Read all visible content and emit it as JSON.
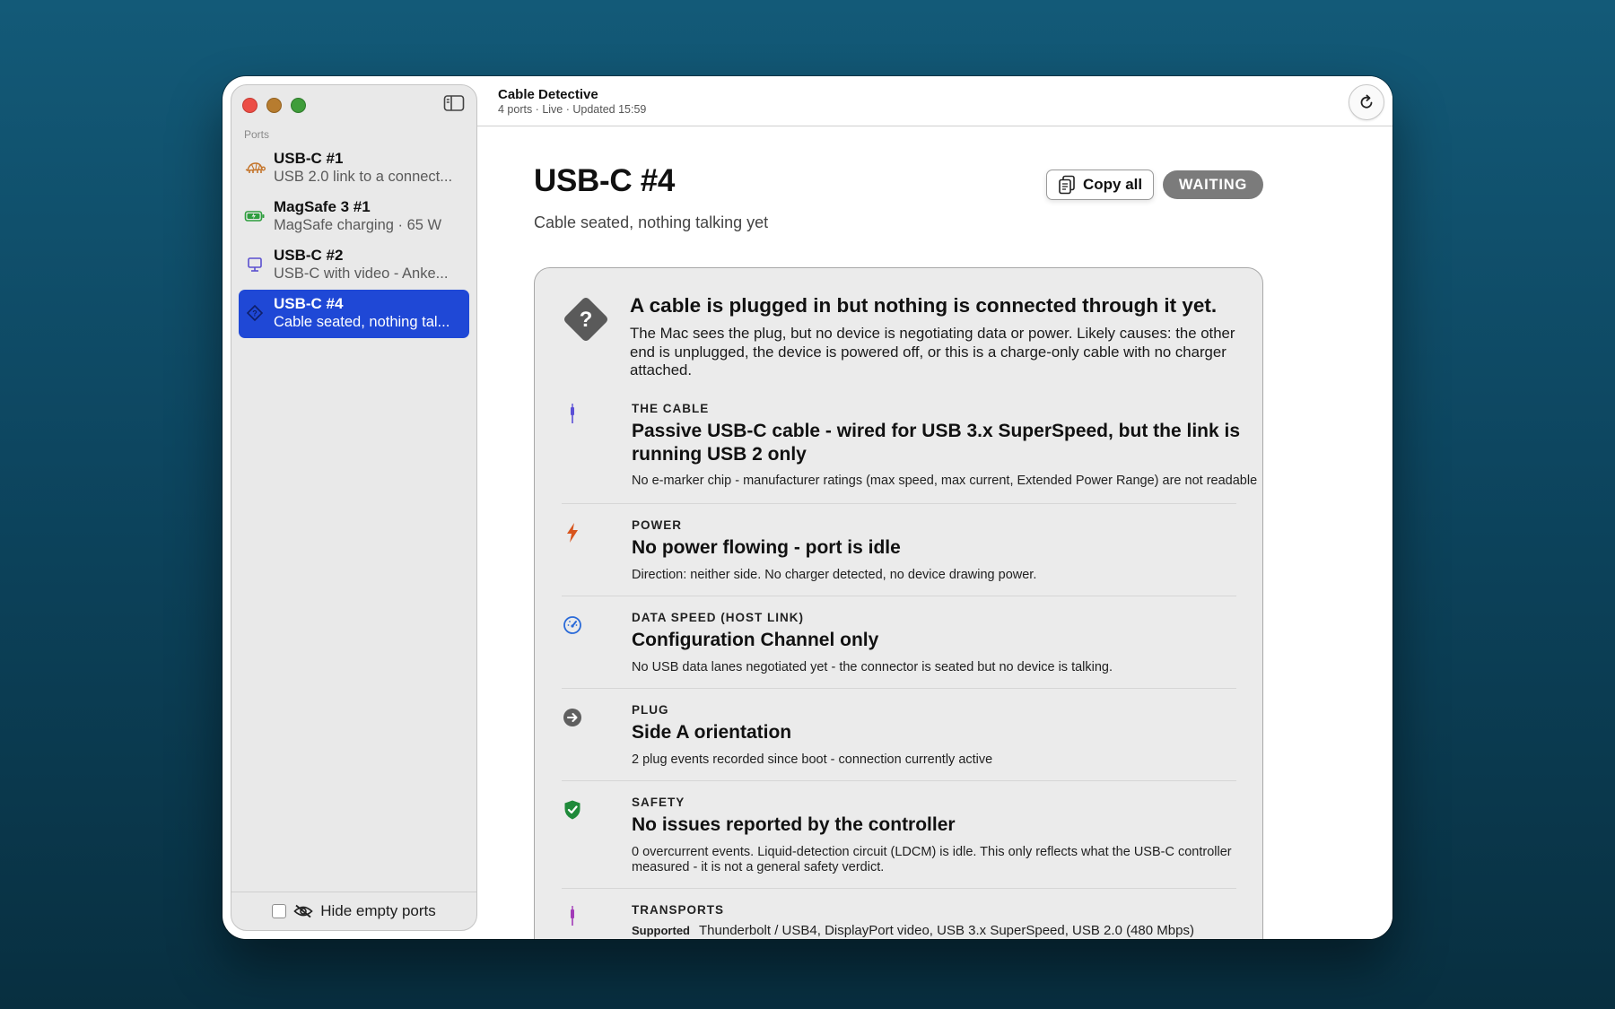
{
  "app": {
    "title": "Cable Detective",
    "subtitle": "4 ports · Live · Updated 15:59"
  },
  "sidebar": {
    "section_label": "Ports",
    "items": [
      {
        "title": "USB-C #1",
        "subtitle": "USB 2.0 link to a connect...",
        "icon": "turtle-icon",
        "icon_color": "#c4742a",
        "selected": false
      },
      {
        "title": "MagSafe 3 #1",
        "subtitle": "MagSafe charging · 65 W",
        "icon": "battery-charging-icon",
        "icon_color": "#2e9e3e",
        "selected": false
      },
      {
        "title": "USB-C #2",
        "subtitle": "USB-C with video - Anke...",
        "icon": "display-icon",
        "icon_color": "#5a4fcf",
        "selected": false
      },
      {
        "title": "USB-C #4",
        "subtitle": "Cable seated, nothing tal...",
        "icon": "question-diamond-icon",
        "icon_color": "#0e1f6a",
        "selected": true
      }
    ],
    "footer": {
      "label": "Hide empty ports",
      "checked": false
    }
  },
  "detail": {
    "title": "USB-C #4",
    "subtitle": "Cable seated, nothing talking yet",
    "copy_label": "Copy all",
    "status": "WAITING",
    "status_color": "#7b7b7b",
    "alert": {
      "title": "A cable is plugged in but nothing is connected through it yet.",
      "body": "The Mac sees the plug, but no device is negotiating data or power. Likely causes: the other end is unplugged, the device is powered off, or this is a charge-only cable with no charger attached."
    },
    "rows": [
      {
        "label": "THE CABLE",
        "icon": "cable-icon",
        "color": "#5b4fd6",
        "value": "Passive USB-C cable - wired for USB 3.x SuperSpeed, but the link is running USB 2 only",
        "detail": "No e-marker chip - manufacturer ratings (max speed, max current, Extended Power Range) are not readable"
      },
      {
        "label": "POWER",
        "icon": "bolt-icon",
        "color": "#d8541c",
        "value": "No power flowing - port is idle",
        "detail": "Direction: neither side. No charger detected, no device drawing power."
      },
      {
        "label": "DATA SPEED (HOST LINK)",
        "icon": "gauge-icon",
        "color": "#2a6ad8",
        "value": "Configuration Channel only",
        "detail": "No USB data lanes negotiated yet - the connector is seated but no device is talking."
      },
      {
        "label": "PLUG",
        "icon": "arrow-circle-icon",
        "color": "#5f5f5f",
        "value": "Side A orientation",
        "detail": "2 plug events recorded since boot - connection currently active"
      },
      {
        "label": "SAFETY",
        "icon": "shield-check-icon",
        "color": "#1f8a3a",
        "value": "No issues reported by the controller",
        "detail": "0 overcurrent events. Liquid-detection circuit (LDCM) is idle. This only reflects what the USB-C controller measured - it is not a general safety verdict."
      },
      {
        "label": "TRANSPORTS",
        "icon": "plug-icon",
        "color": "#a23bb8",
        "supported_label": "Supported",
        "supported": "Thunderbolt / USB4, DisplayPort video, USB 3.x SuperSpeed, USB 2.0 (480 Mbps)"
      }
    ]
  }
}
